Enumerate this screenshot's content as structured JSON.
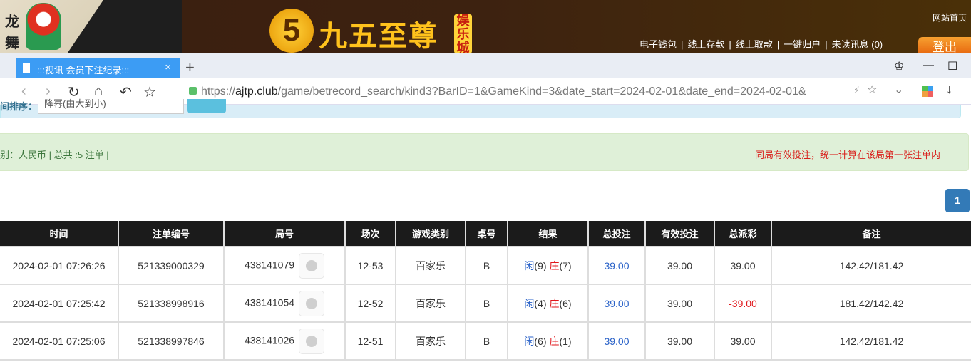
{
  "banner": {
    "side_chars": [
      "龙",
      "舞"
    ],
    "logo_digit": "5",
    "logo_text": "九五至尊",
    "logo_badge": "娱乐城",
    "home_link": "网站首页",
    "nav_links": [
      "电子钱包",
      "线上存款",
      "线上取款",
      "一键归户",
      "未读讯息 (0)"
    ],
    "logout": "登出"
  },
  "browser": {
    "tab_title": ":::视讯 会员下注纪录:::",
    "tab_close": "×",
    "new_tab": "+",
    "url_scheme": "https://",
    "url_domain": "ajtp.club",
    "url_path": "/game/betrecord_search/kind3?BarID=1&GameKind=3&date_start=2024-02-01&date_end=2024-02-01&",
    "icons": {
      "back": "‹",
      "forward": "›",
      "reload": "↻",
      "home": "⌂",
      "undo": "↶",
      "star": "☆",
      "lightning": "⚡",
      "dropdown": "⌄",
      "download": "↓",
      "minimize": "—",
      "maximize": "☐",
      "skin": "♔"
    }
  },
  "filter": {
    "sort_label": "间排序：",
    "sort_value": "降幂(由大到小)"
  },
  "summary": "别：人民币 | 总共 :5 注单 |",
  "notice": "同局有效投注，统一计算在该局第一张注单内",
  "pagination": {
    "current": "1"
  },
  "table": {
    "headers": [
      "时间",
      "注单编号",
      "局号",
      "场次",
      "游戏类别",
      "桌号",
      "结果",
      "总投注",
      "有效投注",
      "总派彩",
      "备注"
    ],
    "rows": [
      {
        "time": "2024-02-01 07:26:26",
        "bet_id": "521339000329",
        "round": "438141079",
        "session": "12-53",
        "game": "百家乐",
        "table": "B",
        "player": "闲",
        "player_pts": "(9)",
        "banker": "庄",
        "banker_pts": "(7)",
        "total": "39.00",
        "valid": "39.00",
        "payout": "39.00",
        "payout_neg": false,
        "note": "142.42/181.42"
      },
      {
        "time": "2024-02-01 07:25:42",
        "bet_id": "521338998916",
        "round": "438141054",
        "session": "12-52",
        "game": "百家乐",
        "table": "B",
        "player": "闲",
        "player_pts": "(4)",
        "banker": "庄",
        "banker_pts": "(6)",
        "total": "39.00",
        "valid": "39.00",
        "payout": "-39.00",
        "payout_neg": true,
        "note": "181.42/142.42"
      },
      {
        "time": "2024-02-01 07:25:06",
        "bet_id": "521338997846",
        "round": "438141026",
        "session": "12-51",
        "game": "百家乐",
        "table": "B",
        "player": "闲",
        "player_pts": "(6)",
        "banker": "庄",
        "banker_pts": "(1)",
        "total": "39.00",
        "valid": "39.00",
        "payout": "39.00",
        "payout_neg": false,
        "note": "142.42/181.42"
      }
    ]
  }
}
